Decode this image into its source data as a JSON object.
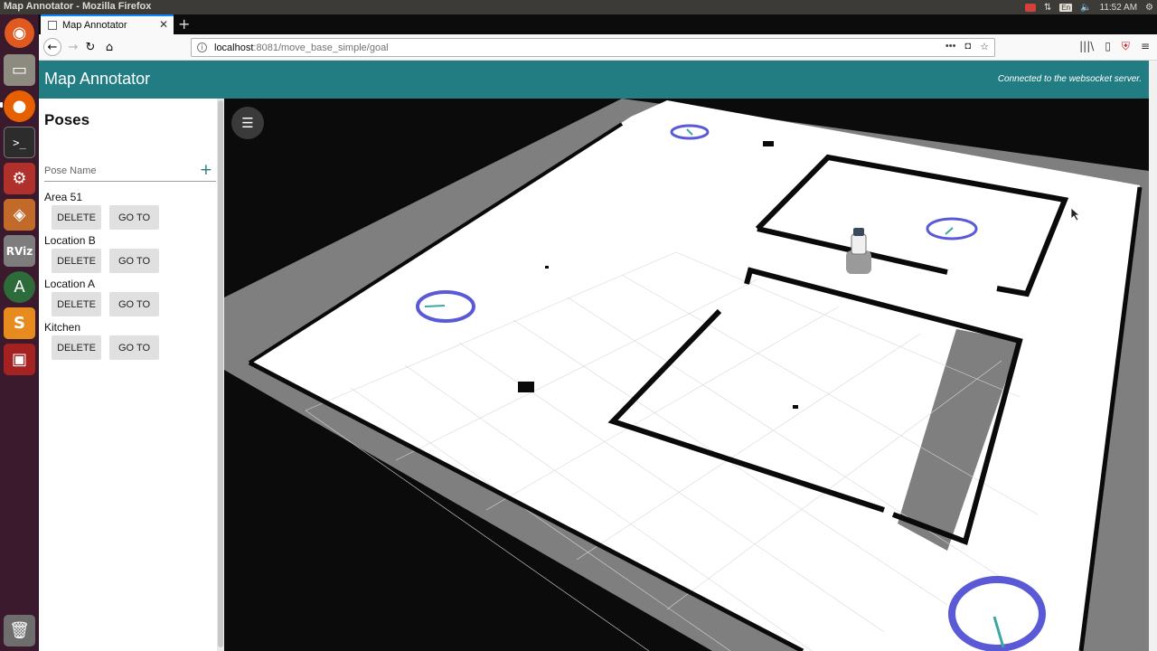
{
  "os": {
    "window_title": "Map Annotator - Mozilla Firefox",
    "keyboard_layout": "En",
    "clock": "11:52 AM",
    "launcher_icons": [
      "ubuntu-icon",
      "files-icon",
      "firefox-icon",
      "terminal-icon",
      "settings-icon",
      "package-icon",
      "rviz-icon",
      "software-updater-icon",
      "sublime-icon",
      "screen-recorder-icon",
      "trash-icon"
    ],
    "rviz_label": "RViz"
  },
  "browser": {
    "tab_title": "Map Annotator",
    "url_host": "localhost",
    "url_path": ":8081/move_base_simple/goal"
  },
  "app": {
    "title": "Map Annotator",
    "status": "Connected to the websocket server.",
    "accent_color": "#227d83"
  },
  "sidebar": {
    "title": "Poses",
    "input_placeholder": "Pose Name",
    "input_value": "",
    "add_label": "+",
    "delete_label": "DELETE",
    "goto_label": "GO TO",
    "poses": [
      {
        "name": "Area 51"
      },
      {
        "name": "Location B"
      },
      {
        "name": "Location A"
      },
      {
        "name": "Kitchen"
      }
    ]
  },
  "viewer": {
    "menu_icon": "menu-icon",
    "map_colors": {
      "free": "#ffffff",
      "unknown": "#7f7f7f",
      "occupied": "#0a0a0a",
      "background": "#0b0b0b",
      "pose_marker": "#5a5ad6",
      "pose_arrow": "#3aa8a0"
    }
  }
}
